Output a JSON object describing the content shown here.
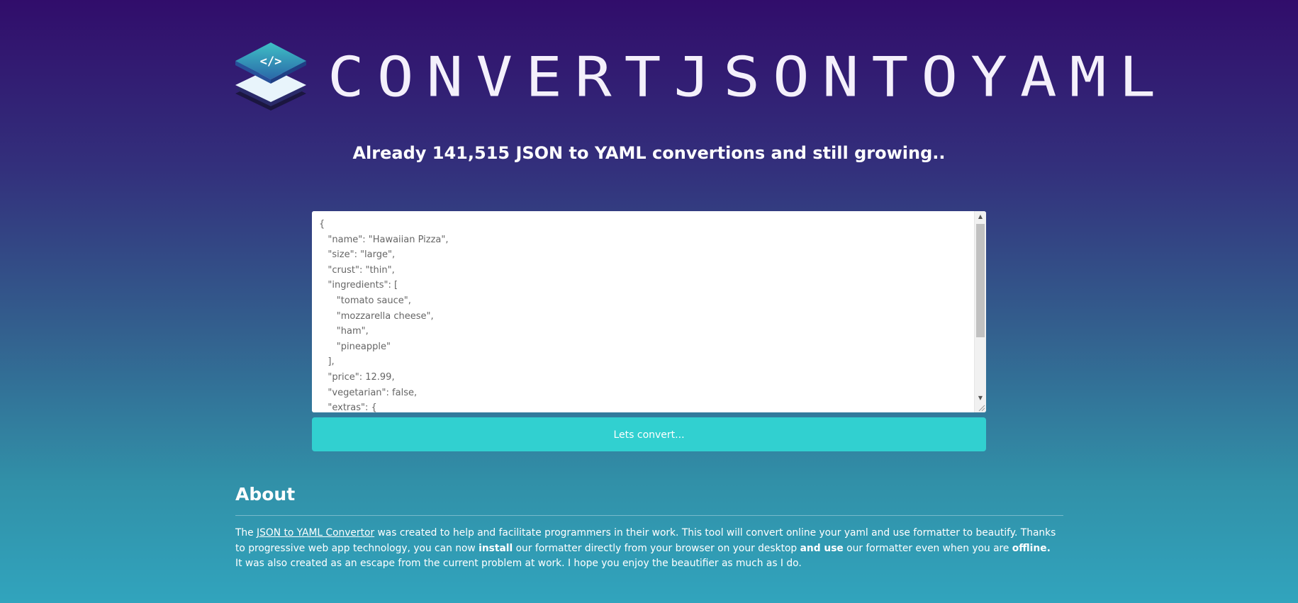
{
  "header": {
    "site_title": "CONVERTJSONTOYAML",
    "logo_icon": "layered-code-brackets-logo"
  },
  "subtitle": "Already 141,515 JSON to YAML convertions and still growing..",
  "editor": {
    "value": "{\n   \"name\": \"Hawaiian Pizza\",\n   \"size\": \"large\",\n   \"crust\": \"thin\",\n   \"ingredients\": [\n      \"tomato sauce\",\n      \"mozzarella cheese\",\n      \"ham\",\n      \"pineapple\"\n   ],\n   \"price\": 12.99,\n   \"vegetarian\": false,\n   \"extras\": {"
  },
  "convert_button": {
    "label": "Lets convert..."
  },
  "about": {
    "title": "About",
    "p1_before_link": "The ",
    "link_text": "JSON to YAML Convertor",
    "p1_after_link": " was created to help and facilitate programmers in their work. This tool will convert online your yaml and use formatter to beautify. Thanks to progressive web app technology, you can now ",
    "install_bold": "install",
    "p1_mid": " our formatter directly from your browser on your desktop ",
    "and_use_bold": "and use",
    "p1_end": " our formatter even when you are ",
    "offline_bold": "offline",
    "p1_period": ".",
    "p2": "It was also created as an escape from the current problem at work. I hope you enjoy the beautifier as much as I do."
  },
  "colors": {
    "gradient_top": "#310d6b",
    "gradient_bottom": "#31a4bd",
    "button": "#31d0d0"
  }
}
